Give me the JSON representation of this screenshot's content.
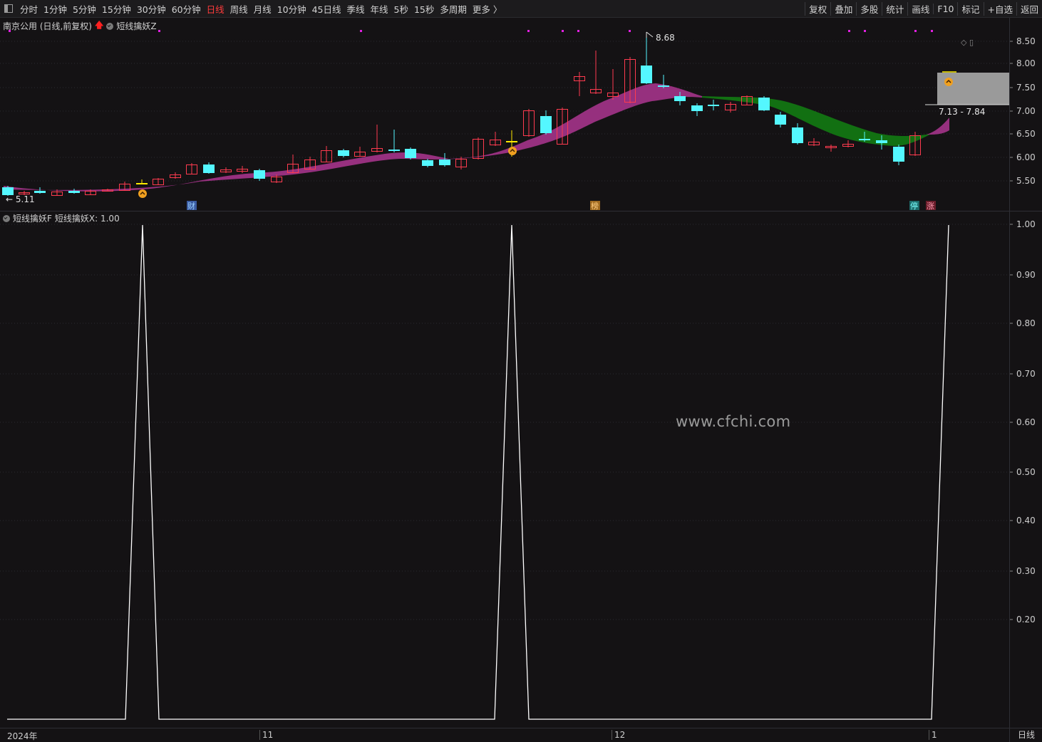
{
  "toolbar": {
    "periods": [
      "分时",
      "1分钟",
      "5分钟",
      "15分钟",
      "30分钟",
      "60分钟",
      "日线",
      "周线",
      "月线",
      "10分钟",
      "45日线",
      "季线",
      "年线",
      "5秒",
      "15秒",
      "多周期",
      "更多 〉"
    ],
    "active": "日线",
    "right": [
      "复权",
      "叠加",
      "多股",
      "统计",
      "画线",
      "F10",
      "标记",
      "+自选",
      "返回"
    ]
  },
  "main_panel": {
    "title": "南京公用 (日线,前复权)",
    "indicator": "短线擒妖Z",
    "y_ticks": [
      "8.50",
      "8.00",
      "7.50",
      "7.00",
      "6.50",
      "6.00",
      "5.50"
    ],
    "high_label": "8.68",
    "low_label": "5.11",
    "range_label": "7.13 - 7.84",
    "badges": [
      "财",
      "榜",
      "停",
      "涨"
    ]
  },
  "sub_panel": {
    "indicator": "短线擒妖F",
    "value_label": "短线擒妖X: 1.00",
    "y_ticks": [
      "1.00",
      "0.90",
      "0.80",
      "0.70",
      "0.60",
      "0.50",
      "0.40",
      "0.30",
      "0.20"
    ]
  },
  "x_axis": {
    "labels": [
      "2024年",
      "11",
      "12",
      "1"
    ],
    "period": "日线"
  },
  "watermark": "www.cfchi.com",
  "colors": {
    "up": "#ff3b4f",
    "down": "#54f7ff",
    "band_up": "#9a3282",
    "band_down": "#157015",
    "signal": "#ffffff"
  }
}
